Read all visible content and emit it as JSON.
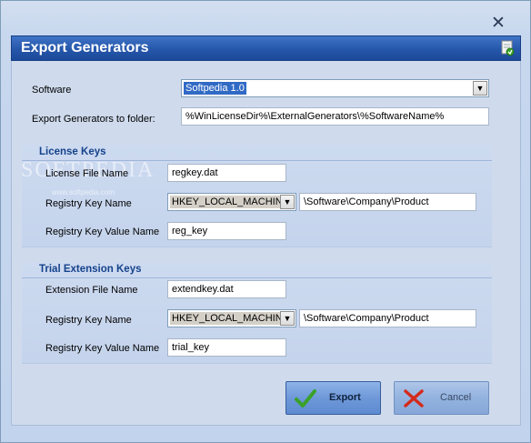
{
  "window": {
    "close_glyph": "✕"
  },
  "header": {
    "title": "Export Generators",
    "icon": "export-doc-icon"
  },
  "software": {
    "label": "Software",
    "selected": "Softpedia 1.0"
  },
  "folder": {
    "label": "Export Generators to folder:",
    "value": "%WinLicenseDir%\\ExternalGenerators\\%SoftwareName%"
  },
  "license_keys": {
    "title": "License Keys",
    "file_label": "License File Name",
    "file_value": "regkey.dat",
    "reg_key_label": "Registry Key Name",
    "reg_key_root": "HKEY_LOCAL_MACHINE",
    "reg_key_path": "\\Software\\Company\\Product",
    "reg_value_label": "Registry Key Value Name",
    "reg_value": "reg_key"
  },
  "trial_keys": {
    "title": "Trial Extension Keys",
    "file_label": "Extension File Name",
    "file_value": "extendkey.dat",
    "reg_key_label": "Registry Key Name",
    "reg_key_root": "HKEY_LOCAL_MACHINE",
    "reg_key_path": "\\Software\\Company\\Product",
    "reg_value_label": "Registry Key Value Name",
    "reg_value": "trial_key"
  },
  "watermark": {
    "text": "SOFTPEDIA",
    "sub": "www.softpedia.com"
  },
  "buttons": {
    "export_label": "Export",
    "cancel_label": "Cancel"
  },
  "colors": {
    "header": "#2556aa",
    "group_title": "#15428b",
    "check_green": "#3aa12a",
    "cancel_red": "#d42a1c"
  }
}
